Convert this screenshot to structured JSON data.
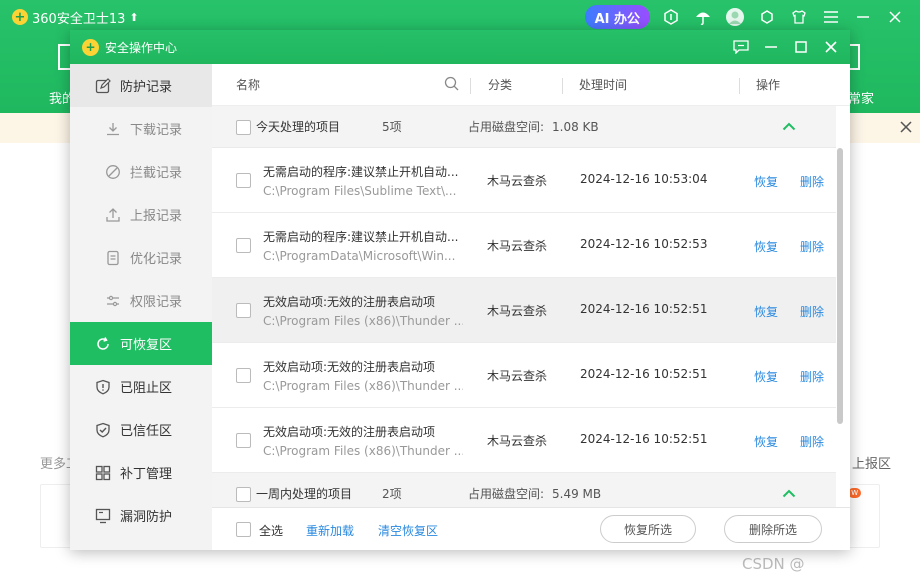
{
  "app": {
    "title": "360安全卫士13",
    "ai_button": "AI 办公",
    "left_label": "我的",
    "right_label": "常家",
    "more_left": "更多工",
    "more_right": "上报区",
    "new_badge": "w",
    "watermark": "CSDN @"
  },
  "dialog": {
    "title": "安全操作中心"
  },
  "sidebar": {
    "items": [
      {
        "label": "防护记录",
        "icon": "edit-icon"
      },
      {
        "label": "下载记录",
        "icon": "download-icon"
      },
      {
        "label": "拦截记录",
        "icon": "block-icon"
      },
      {
        "label": "上报记录",
        "icon": "upload-icon"
      },
      {
        "label": "优化记录",
        "icon": "document-icon"
      },
      {
        "label": "权限记录",
        "icon": "sliders-icon"
      },
      {
        "label": "可恢复区",
        "icon": "refresh-icon"
      },
      {
        "label": "已阻止区",
        "icon": "shield-exclaim-icon"
      },
      {
        "label": "已信任区",
        "icon": "shield-check-icon"
      },
      {
        "label": "补丁管理",
        "icon": "grid-icon"
      },
      {
        "label": "漏洞防护",
        "icon": "monitor-icon"
      }
    ]
  },
  "table": {
    "headers": {
      "name": "名称",
      "category": "分类",
      "time": "处理时间",
      "action": "操作"
    },
    "groups": [
      {
        "title": "今天处理的项目",
        "count": "5项",
        "disk_label": "占用磁盘空间:",
        "disk": "1.08 KB"
      },
      {
        "title": "一周内处理的项目",
        "count": "2项",
        "disk_label": "占用磁盘空间:",
        "disk": "5.49 MB"
      }
    ],
    "rows": [
      {
        "title": "无需启动的程序:建议禁止开机自动...",
        "path": "C:\\Program Files\\Sublime Text\\...",
        "category": "木马云查杀",
        "time": "2024-12-16 10:53:04",
        "restore": "恢复",
        "delete": "删除"
      },
      {
        "title": "无需启动的程序:建议禁止开机自动...",
        "path": "C:\\ProgramData\\Microsoft\\Win...",
        "category": "木马云查杀",
        "time": "2024-12-16 10:52:53",
        "restore": "恢复",
        "delete": "删除"
      },
      {
        "title": "无效启动项:无效的注册表启动项",
        "path": "C:\\Program Files (x86)\\Thunder ...",
        "category": "木马云查杀",
        "time": "2024-12-16 10:52:51",
        "restore": "恢复",
        "delete": "删除"
      },
      {
        "title": "无效启动项:无效的注册表启动项",
        "path": "C:\\Program Files (x86)\\Thunder ...",
        "category": "木马云查杀",
        "time": "2024-12-16 10:52:51",
        "restore": "恢复",
        "delete": "删除"
      },
      {
        "title": "无效启动项:无效的注册表启动项",
        "path": "C:\\Program Files (x86)\\Thunder ...",
        "category": "木马云查杀",
        "time": "2024-12-16 10:52:51",
        "restore": "恢复",
        "delete": "删除"
      }
    ]
  },
  "footer": {
    "select_all": "全选",
    "reload": "重新加载",
    "clear": "清空恢复区",
    "restore_selected": "恢复所选",
    "delete_selected": "删除所选"
  }
}
